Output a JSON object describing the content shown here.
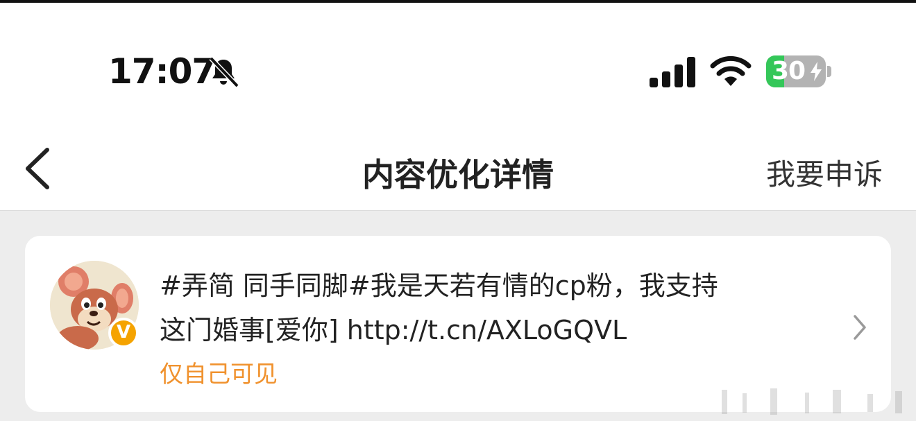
{
  "status_bar": {
    "time": "17:07",
    "battery": "30",
    "battery_level": 0.3,
    "icons": [
      "bell-slash-icon",
      "cellular-signal-icon",
      "wifi-icon",
      "battery-charging-icon"
    ]
  },
  "nav": {
    "title": "内容优化详情",
    "appeal_label": "我要申诉",
    "back_icon": "chevron-left-icon"
  },
  "post": {
    "text_line1": "#弄简 同手同脚#我是天若有情的cp粉，我支持",
    "text_line2": "这门婚事[爱你] http://t.cn/AXLoGQVL",
    "visibility": "仅自己可见",
    "badge": "V",
    "avatar_icon": "cartoon-mouse-avatar",
    "open_icon": "chevron-right-icon"
  },
  "colors": {
    "page_bg": "#ededed",
    "card_bg": "#ffffff",
    "visibility": "#f0922e",
    "battery_green": "#34c759",
    "badge": "#f5a300"
  }
}
